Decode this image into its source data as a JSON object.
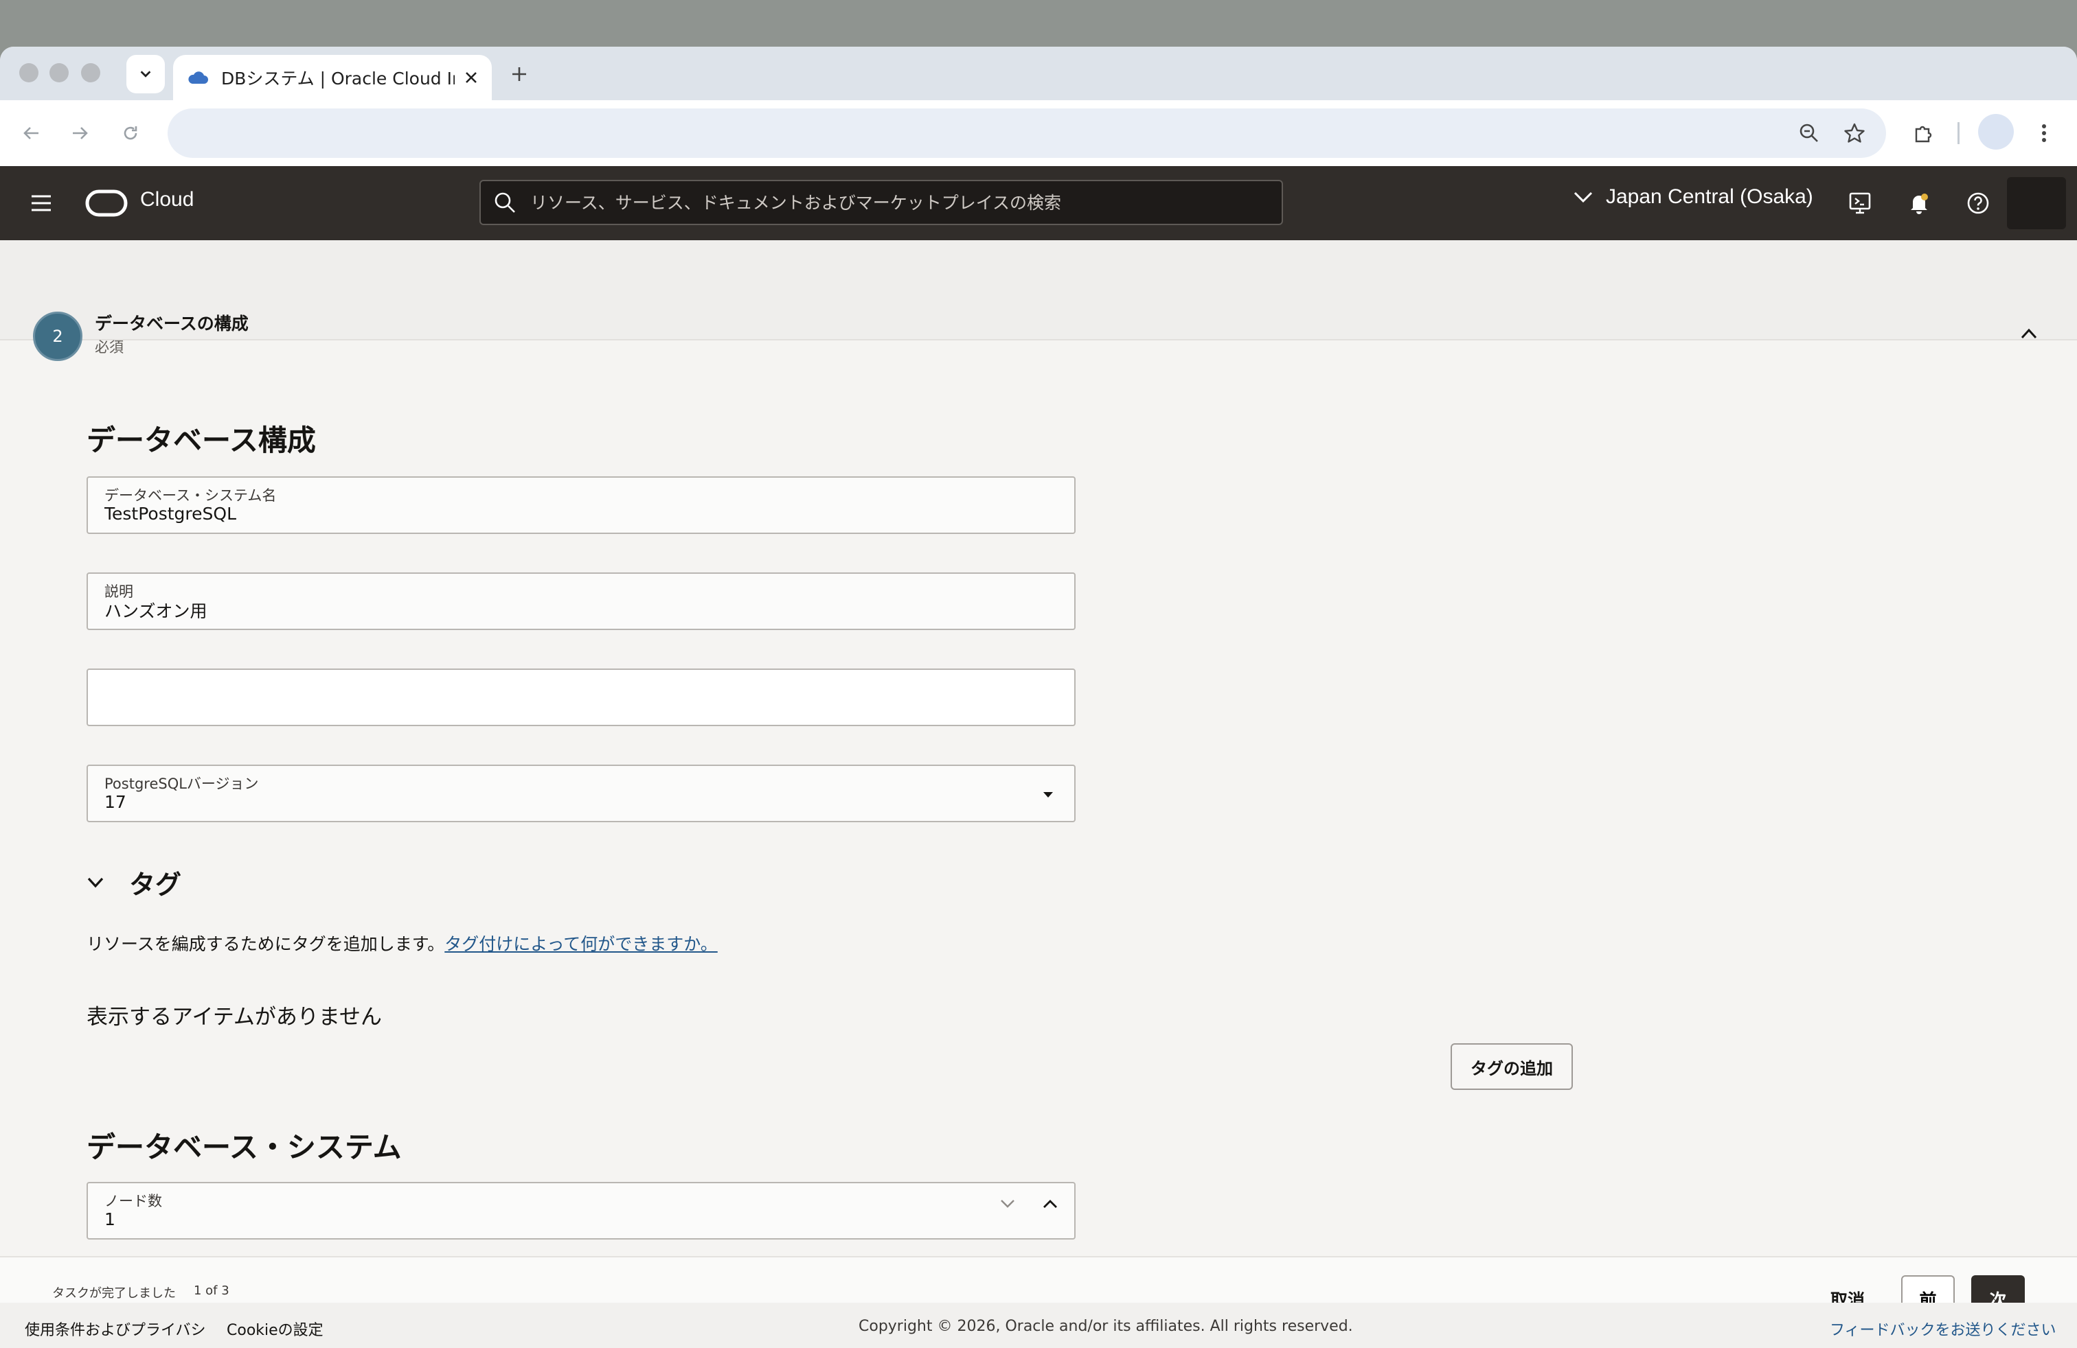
{
  "browser": {
    "tab_title": "DBシステム | Oracle Cloud Infr"
  },
  "header": {
    "brand": "Cloud",
    "search_placeholder": "リソース、サービス、ドキュメントおよびマーケットプレイスの検索",
    "region": "Japan Central (Osaka)"
  },
  "step": {
    "number": "2",
    "title": "データベースの構成",
    "subtitle": "必須"
  },
  "form": {
    "section_title": "データベース構成",
    "db_system_name": {
      "label": "データベース・システム名",
      "value": "TestPostgreSQL"
    },
    "description": {
      "label": "説明",
      "value": "ハンズオン用"
    },
    "extra_field": {
      "value": ""
    },
    "pg_version": {
      "label": "PostgreSQLバージョン",
      "value": "17"
    }
  },
  "tags": {
    "title": "タグ",
    "description": "リソースを編成するためにタグを追加します。",
    "link_text": "タグ付けによって何ができますか。",
    "empty_text": "表示するアイテムがありません",
    "add_button": "タグの追加"
  },
  "db_system": {
    "section_title": "データベース・システム",
    "node_count": {
      "label": "ノード数",
      "value": "1"
    }
  },
  "footer_bar": {
    "progress_label": "タスクが完了しました",
    "progress_count": "1 of 3",
    "progress_fraction": 0.33,
    "cancel": "取消",
    "prev": "前",
    "next": "次"
  },
  "page_footer": {
    "terms": "使用条件およびプライバシ",
    "cookies": "Cookieの設定",
    "copyright": "Copyright © 2026, Oracle and/or its affiliates. All rights reserved.",
    "feedback": "フィードバックをお送りください"
  }
}
